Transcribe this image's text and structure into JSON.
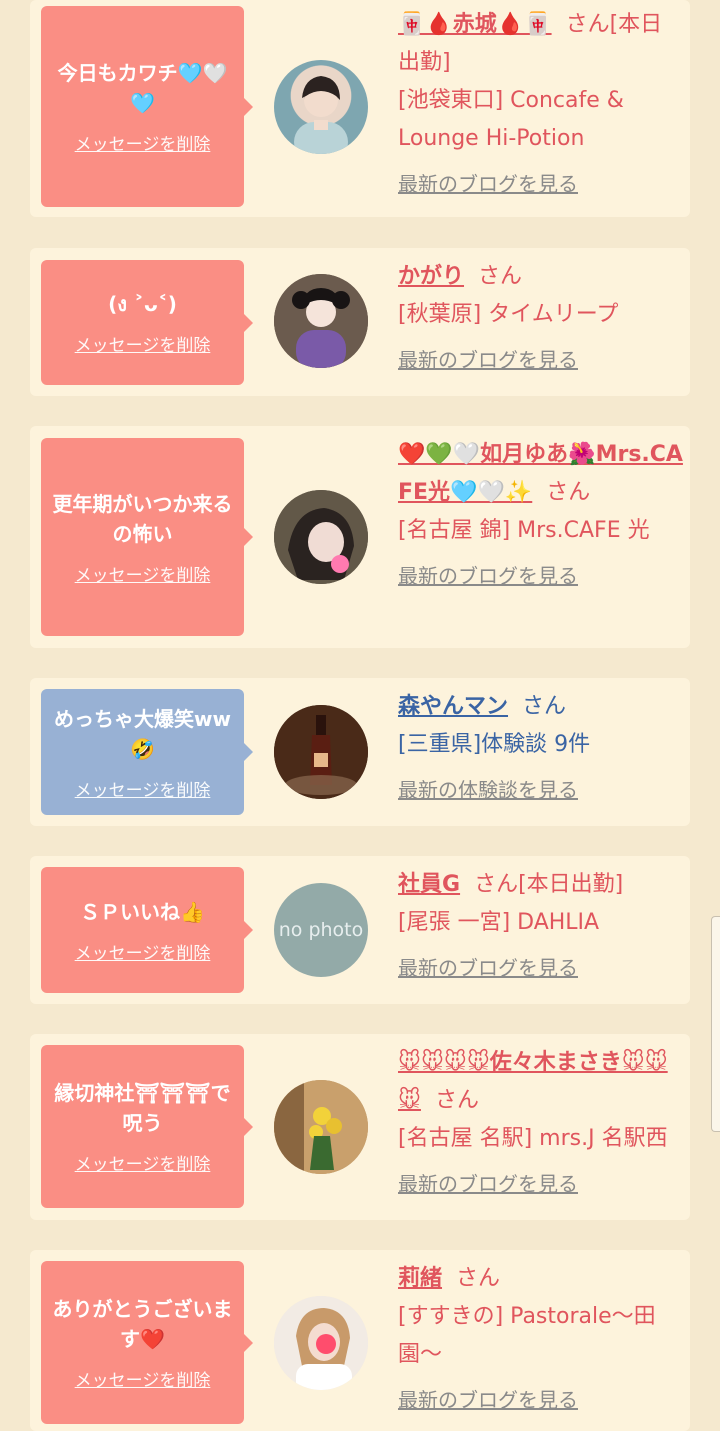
{
  "delete_label": "メッセージを削除",
  "honorific": "さん",
  "cards": [
    {
      "message": "今日もカワチ🩵🤍🩵",
      "name": "🀄🩸赤城🩸🀄",
      "suffix": "[本日出勤]",
      "shop": "[池袋東口] Concafe & Lounge Hi-Potion",
      "link": "最新のブログを見る"
    },
    {
      "message": "(ง ˃ᴗ˂)",
      "name": "かがり",
      "suffix": "",
      "shop": "[秋葉原] タイムリープ",
      "link": "最新のブログを見る"
    },
    {
      "message": "更年期がいつか来るの怖い",
      "name": "❤️💚🤍如月ゆあ🌺Mrs.CAFE光🩵🤍✨",
      "suffix": "",
      "shop": "[名古屋 錦] Mrs.CAFE 光",
      "link": "最新のブログを見る"
    },
    {
      "message": "めっちゃ大爆笑ww🤣",
      "name": "森やんマン",
      "suffix": "",
      "shop": "[三重県]体験談 9件",
      "link": "最新の体験談を見る"
    },
    {
      "message": "ＳＰいいね👍",
      "name": "社員G",
      "suffix": "[本日出勤]",
      "shop": "[尾張 一宮] DAHLIA",
      "link": "最新のブログを見る",
      "avatar_text": "no photo"
    },
    {
      "message": "縁切神社⛩⛩⛩で呪う",
      "name": "🐭🐭🐭🐭佐々木まさき🐭🐭🐭",
      "suffix": "",
      "shop": "[名古屋 名駅] mrs.J 名駅西",
      "link": "最新のブログを見る"
    },
    {
      "message": "ありがとうございます❤️",
      "name": "莉緒",
      "suffix": "",
      "shop": "[すすきの] Pastorale〜田園〜",
      "link": "最新のブログを見る"
    }
  ],
  "colors": {
    "page_bg": "#f5e9cf",
    "card_bg": "#fdf3dc",
    "bubble_pink": "#fa8e84",
    "bubble_blue": "#98b1d4",
    "name_red": "#e0555d",
    "name_blue": "#3a64a4",
    "link_gray": "#8a8a8a"
  }
}
